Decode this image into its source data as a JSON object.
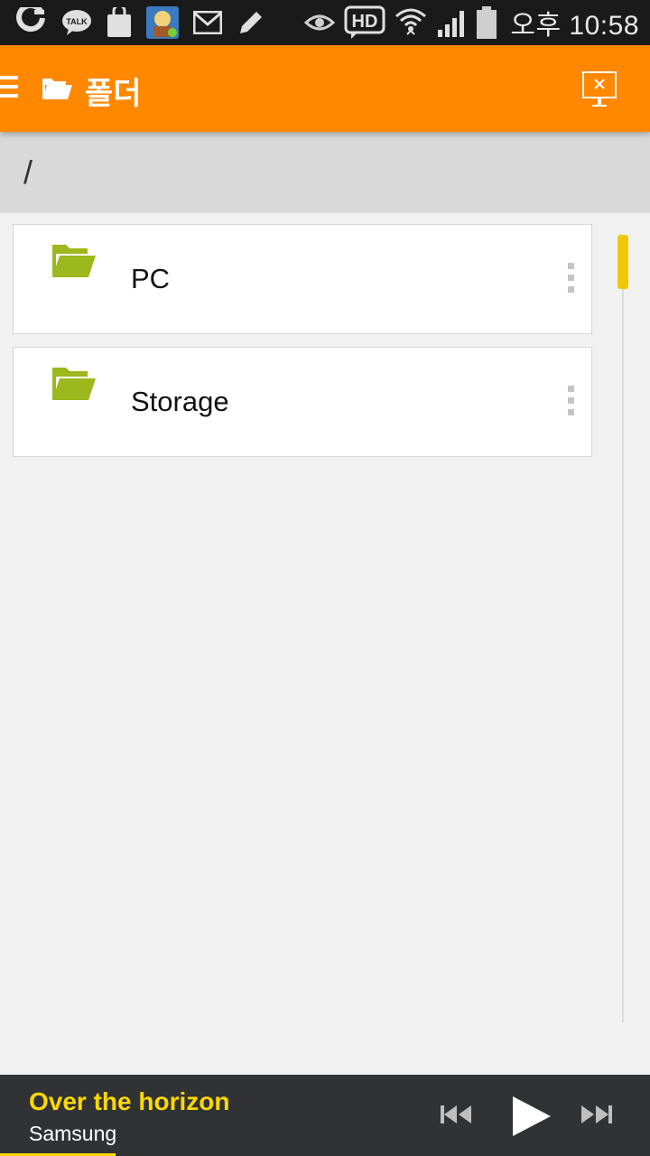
{
  "status_bar": {
    "time": "오후 10:58",
    "notification_icons": [
      "o-app-icon",
      "kakaotalk-icon",
      "galaxy-apps-icon",
      "game-avatar-icon",
      "gmail-icon",
      "pencil-icon"
    ],
    "system_icons": [
      "eye-icon",
      "hd-voice-icon",
      "wifi-icon",
      "signal-icon",
      "battery-icon"
    ],
    "talk_label": "TALK",
    "hd_label": "HD"
  },
  "app_bar": {
    "title": "폴더",
    "accent_color": "#ff8800"
  },
  "path": {
    "current": "/"
  },
  "folders": [
    {
      "label": "PC",
      "icon": "folder-open-icon"
    },
    {
      "label": "Storage",
      "icon": "folder-open-icon"
    }
  ],
  "colors": {
    "folder_icon": "#9cb81c",
    "player_title": "#ffd800",
    "scroll_thumb": "#f0c800"
  },
  "player": {
    "title": "Over the horizon",
    "artist": "Samsung",
    "controls": [
      "previous-icon",
      "play-icon",
      "next-icon"
    ]
  }
}
